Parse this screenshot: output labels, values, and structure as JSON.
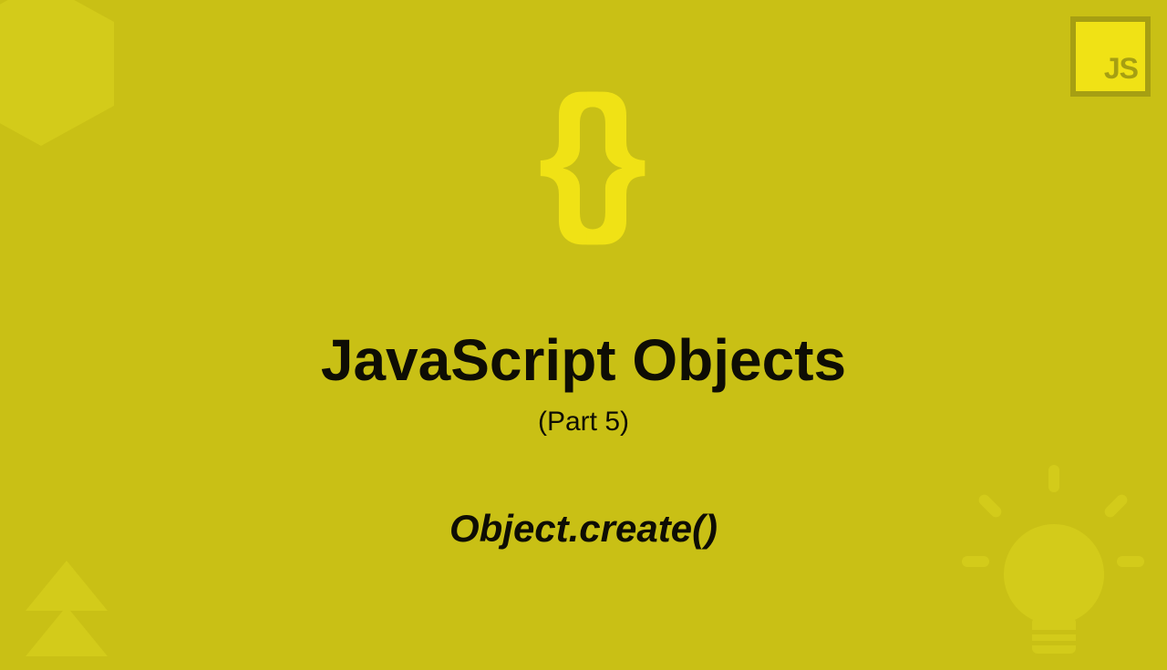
{
  "badge": {
    "label": "JS"
  },
  "braces": "{}",
  "title": "JavaScript Objects",
  "subtitle": "(Part 5)",
  "method": "Object.create()",
  "colors": {
    "background": "#c9c015",
    "accent": "#f0e215",
    "dark": "#a69f12",
    "text": "#0e0d04"
  }
}
